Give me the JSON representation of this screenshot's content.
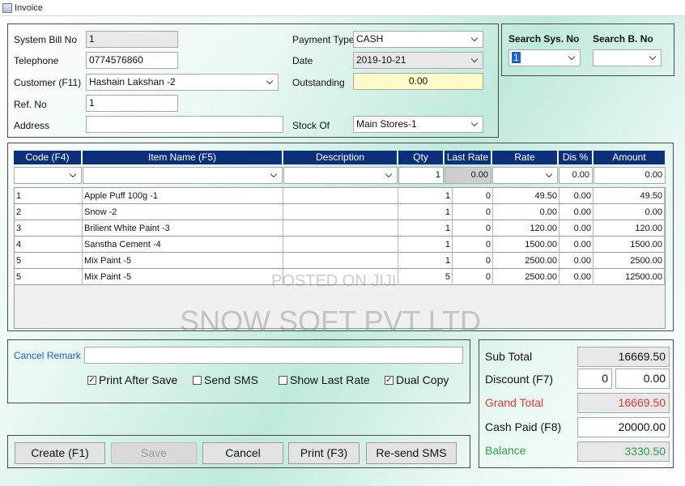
{
  "window": {
    "title": "Invoice"
  },
  "header": {
    "system_bill_no_label": "System Bill No",
    "system_bill_no_value": "1",
    "telephone_label": "Telephone",
    "telephone_value": "0774576860",
    "customer_label": "Customer (F11)",
    "customer_value": "Hashain Lakshan -2",
    "ref_no_label": "Ref. No",
    "ref_no_value": "1",
    "address_label": "Address",
    "address_value": "",
    "payment_type_label": "Payment Type",
    "payment_type_value": "CASH",
    "date_label": "Date",
    "date_value": "2019-10-21",
    "outstanding_label": "Outstanding",
    "outstanding_value": "0.00",
    "stock_of_label": "Stock Of",
    "stock_of_value": "Main Stores-1"
  },
  "search": {
    "sys_no_label": "Search Sys. No",
    "sys_no_value": "1",
    "bill_no_label": "Search B. No",
    "bill_no_value": ""
  },
  "grid": {
    "columns": [
      "Code (F4)",
      "Item Name (F5)",
      "Description",
      "Qty",
      "Last Rate",
      "Rate",
      "Dis %",
      "Amount"
    ],
    "filter": {
      "qty": "1",
      "last_rate": "0.00",
      "dis": "0.00",
      "amount": "0.00"
    },
    "rows": [
      {
        "code": "1",
        "item": "Apple Puff 100g -1",
        "description": "",
        "qty": "1",
        "last_rate": "0",
        "rate": "49.50",
        "dis": "0.00",
        "amount": "49.50"
      },
      {
        "code": "2",
        "item": "Snow -2",
        "description": "",
        "qty": "1",
        "last_rate": "0",
        "rate": "0.00",
        "dis": "0.00",
        "amount": "0.00"
      },
      {
        "code": "3",
        "item": "Brilient White Paint -3",
        "description": "",
        "qty": "1",
        "last_rate": "0",
        "rate": "120.00",
        "dis": "0.00",
        "amount": "120.00"
      },
      {
        "code": "4",
        "item": "Sanstha Cement -4",
        "description": "",
        "qty": "1",
        "last_rate": "0",
        "rate": "1500.00",
        "dis": "0.00",
        "amount": "1500.00"
      },
      {
        "code": "5",
        "item": "Mix Paint -5",
        "description": "",
        "qty": "1",
        "last_rate": "0",
        "rate": "2500.00",
        "dis": "0.00",
        "amount": "2500.00"
      },
      {
        "code": "5",
        "item": "Mix Paint -5",
        "description": "",
        "qty": "5",
        "last_rate": "0",
        "rate": "2500.00",
        "dis": "0.00",
        "amount": "12500.00"
      }
    ]
  },
  "options": {
    "cancel_remark_label": "Cancel Remark",
    "cancel_remark_value": "",
    "print_after_save": "Print After Save",
    "send_sms": "Send SMS",
    "show_last_rate": "Show Last Rate",
    "dual_copy": "Dual Copy"
  },
  "buttons": {
    "create": "Create (F1)",
    "save": "Save",
    "cancel": "Cancel",
    "print": "Print (F3)",
    "resend_sms": "Re-send SMS"
  },
  "totals": {
    "sub_total_label": "Sub Total",
    "sub_total_value": "16669.50",
    "discount_label": "Discount (F7)",
    "discount_pct": "0",
    "discount_value": "0.00",
    "grand_total_label": "Grand Total",
    "grand_total_value": "16669.50",
    "cash_paid_label": "Cash Paid (F8)",
    "cash_paid_value": "20000.00",
    "balance_label": "Balance",
    "balance_value": "3330.50"
  },
  "watermarks": {
    "posted": "POSTED ON JIJI",
    "company": "SNOW SOFT PVT LTD"
  },
  "colors": {
    "grid_header": "#0c2f7a",
    "grand_total": "#d23a3a",
    "balance": "#2e9a4e",
    "cancel_remark": "#1f5fbf"
  }
}
